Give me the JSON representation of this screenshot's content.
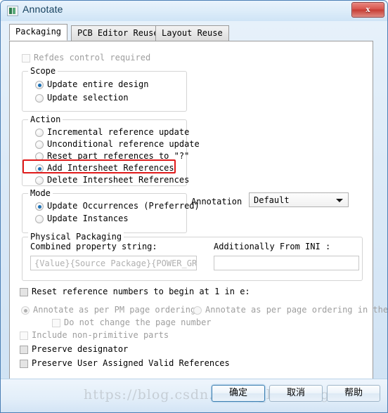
{
  "window": {
    "title": "Annotate",
    "icon": "app-icon",
    "close_label": "x"
  },
  "tabs": [
    {
      "label": "Packaging",
      "active": true
    },
    {
      "label": "PCB Editor Reuse",
      "active": false
    },
    {
      "label": "Layout Reuse",
      "active": false
    }
  ],
  "packaging": {
    "refdes_control": {
      "label": "Refdes control required",
      "checked": false,
      "enabled": false
    },
    "scope": {
      "legend": "Scope",
      "options": [
        {
          "label": "Update entire design",
          "selected": true
        },
        {
          "label": "Update selection",
          "selected": false
        }
      ]
    },
    "action": {
      "legend": "Action",
      "options": [
        {
          "label": "Incremental reference update",
          "selected": false
        },
        {
          "label": "Unconditional reference update",
          "selected": false
        },
        {
          "label": "Reset part references to \"?\"",
          "selected": false
        },
        {
          "label": "Add Intersheet References",
          "selected": true,
          "highlighted": true
        },
        {
          "label": "Delete Intersheet References",
          "selected": false
        }
      ],
      "highlight_color": "#e01b1b"
    },
    "mode": {
      "legend": "Mode",
      "options": [
        {
          "label": "Update Occurrences (Preferred)",
          "selected": true
        },
        {
          "label": "Update Instances",
          "selected": false
        }
      ]
    },
    "annotation": {
      "label": "Annotation",
      "value": "Default"
    },
    "physical_packaging": {
      "legend": "Physical Packaging",
      "combined_property_label": "Combined property string:",
      "combined_property_value": "{Value}{Source Package}{POWER_GROUP}",
      "additionally_from_ini_label": "Additionally From INI :",
      "additionally_from_ini_value": ""
    },
    "reset_reference": {
      "label": "Reset reference numbers to begin at 1 in e:",
      "checked": false
    },
    "page_ordering": [
      {
        "label": "Annotate as per PM page ordering",
        "selected": true,
        "enabled": false
      },
      {
        "label": "Annotate as per page ordering in the ti",
        "selected": false,
        "enabled": false
      }
    ],
    "do_not_change_page_number": {
      "label": "Do not change the page number",
      "checked": false,
      "enabled": false
    },
    "include_non_primitive": {
      "label": "Include non-primitive parts",
      "checked": false,
      "enabled": false
    },
    "preserve_designator": {
      "label": "Preserve designator",
      "checked": false,
      "enabled": true
    },
    "preserve_user_assigned": {
      "label": "Preserve User Assigned Valid References",
      "checked": false,
      "enabled": true
    }
  },
  "footer": {
    "ok_label": "确定",
    "cancel_label": "取消",
    "help_label": "帮助",
    "watermark": "https://blog.csdn.net/sy_lizhuang"
  }
}
